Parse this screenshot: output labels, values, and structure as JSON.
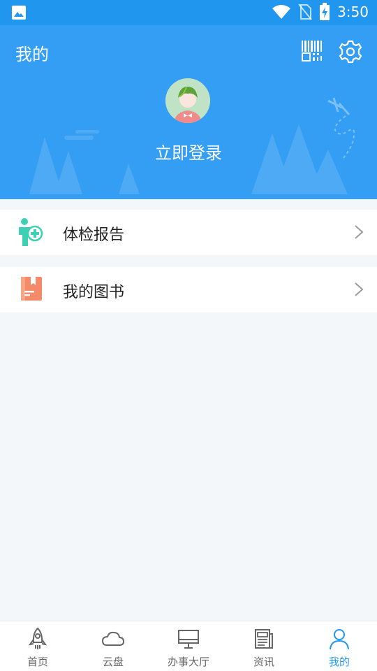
{
  "status_bar": {
    "time": "3:50"
  },
  "header": {
    "title": "我的",
    "login_label": "立即登录"
  },
  "menu": {
    "items": [
      {
        "label": "体检报告",
        "icon": "health-report-icon"
      },
      {
        "label": "我的图书",
        "icon": "book-icon"
      }
    ]
  },
  "tabs": [
    {
      "label": "首页",
      "icon": "rocket-icon",
      "active": false
    },
    {
      "label": "云盘",
      "icon": "cloud-icon",
      "active": false
    },
    {
      "label": "办事大厅",
      "icon": "monitor-icon",
      "active": false
    },
    {
      "label": "资讯",
      "icon": "newspaper-icon",
      "active": false
    },
    {
      "label": "我的",
      "icon": "person-icon",
      "active": true
    }
  ],
  "colors": {
    "primary": "#2196ef",
    "header": "#339ef3",
    "health_icon": "#3ed0b4",
    "book_icon": "#f58a6a"
  }
}
